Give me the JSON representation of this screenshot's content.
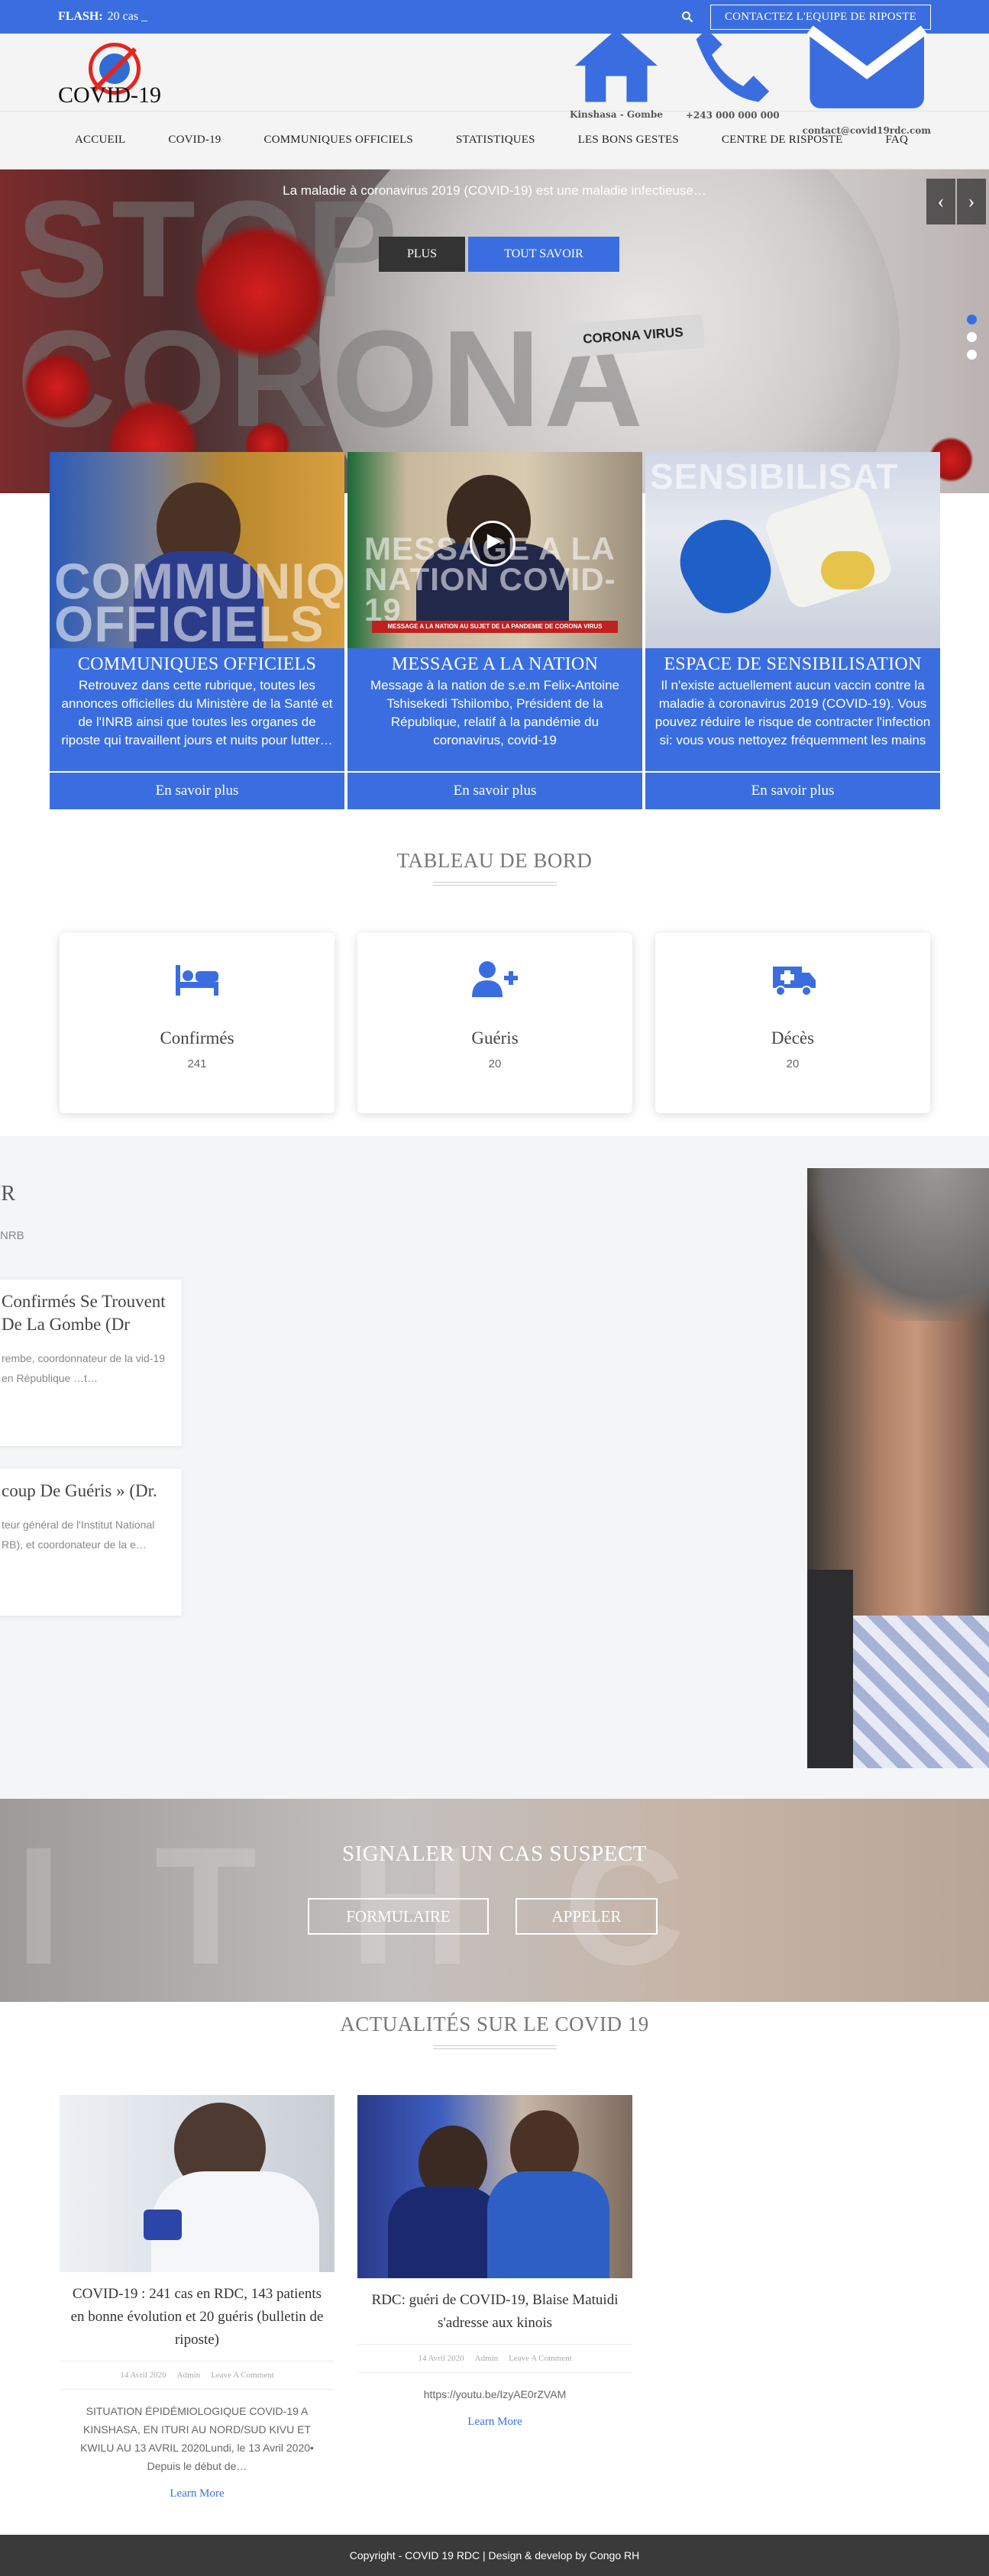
{
  "flash": {
    "label": "FLASH:",
    "text": "20 cas _",
    "contact_button": "CONTACTEZ L'EQUIPE DE RIPOSTE"
  },
  "header": {
    "logo_text": "COVID-19",
    "location": "Kinshasa - Gombe",
    "phone": "+243 000 000 000",
    "email": "contact@covid19rdc.com"
  },
  "nav": [
    "ACCUEIL",
    "COVID-19",
    "COMMUNIQUES OFFICIELS",
    "STATISTIQUES",
    "LES BONS GESTES",
    "CENTRE DE RISPOSTE",
    "FAQ"
  ],
  "hero": {
    "caption": "La maladie à coronavirus 2019 (COVID-19) est une maladie infectieuse…",
    "btn_plus": "PLUS",
    "btn_more": "TOUT SAVOIR",
    "bg_word1": "STOP",
    "bg_word2": "CORONA",
    "tube_label": "CORONA VIRUS",
    "prev": "‹",
    "next": "›"
  },
  "cards": [
    {
      "overlay": "COMMUNIQUES OFFICIELS",
      "title": "COMMUNIQUES OFFICIELS",
      "text": "Retrouvez dans cette rubrique, toutes les annonces officielles du Ministère de la Santé et de l'INRB ainsi que toutes les organes de riposte qui travaillent jours et nuits pour lutter…",
      "more": "En savoir plus"
    },
    {
      "overlay": "MESSAGE A LA NATION COVID-19",
      "title": "MESSAGE A LA NATION",
      "text": "Message à la nation de s.e.m Felix-Antoine Tshisekedi Tshilombo, Président de la République, relatif à la pandémie du coronavirus, covid-19",
      "more": "En savoir plus",
      "banner": "MESSAGE A LA NATION AU SUJET DE LA PANDEMIE DE CORONA VIRUS"
    },
    {
      "overlay": "SENSIBILISAT",
      "title": "ESPACE DE SENSIBILISATION",
      "text": "Il n'existe actuellement aucun vaccin contre la maladie à coronavirus 2019 (COVID-19). Vous pouvez réduire le risque de contracter l'infection si: vous vous nettoyez fréquemment les mains",
      "more": "En savoir plus"
    }
  ],
  "dashboard": {
    "title": "TABLEAU DE BORD",
    "stats": [
      {
        "label": "Confirmés",
        "value": "241",
        "icon": "bed-icon"
      },
      {
        "label": "Guéris",
        "value": "20",
        "icon": "user-plus-icon"
      },
      {
        "label": "Décès",
        "value": "20",
        "icon": "ambulance-icon"
      }
    ]
  },
  "interview": {
    "heading": "IR",
    "sub": "NRB",
    "items": [
      {
        "title": "Confirmés Se Trouvent De La Gombe (Dr",
        "text": "rembe, coordonnateur de la vid-19 en République …t…"
      },
      {
        "title": "coup De Guéris » (Dr.",
        "text": "teur général de l'Institut National RB), et coordonateur de la e…"
      }
    ]
  },
  "signal": {
    "title": "SIGNALER UN CAS SUSPECT",
    "form_button": "FORMULAIRE",
    "call_button": "APPELER"
  },
  "news": {
    "title": "ACTUALITÉS SUR LE COVID 19",
    "posts": [
      {
        "title": "COVID-19 : 241 cas en RDC, 143 patients en bonne évolution et 20 guéris (bulletin de riposte)",
        "date": "14 Avril 2020",
        "author": "Admin",
        "comments": "Leave A Comment",
        "excerpt": "SITUATION ÉPIDÉMIOLOGIQUE COVID-19 A KINSHASA, EN ITURI AU NORD/SUD KIVU ET KWILU AU 13 AVRIL 2020Lundi, le 13 Avril 2020• Depuis le début de…",
        "more": "Learn More"
      },
      {
        "title": "RDC: guéri de COVID-19, Blaise Matuidi s'adresse aux kinois",
        "date": "14 Avril 2020",
        "author": "Admin",
        "comments": "Leave A Comment",
        "excerpt": "https://youtu.be/IzyAE0rZVAM",
        "more": "Learn More"
      }
    ]
  },
  "footer": {
    "text": "Copyright - COVID 19 RDC | Design & develop by Congo RH"
  },
  "colors": {
    "accent": "#3a6ee0",
    "dark": "#3a3a3a"
  }
}
